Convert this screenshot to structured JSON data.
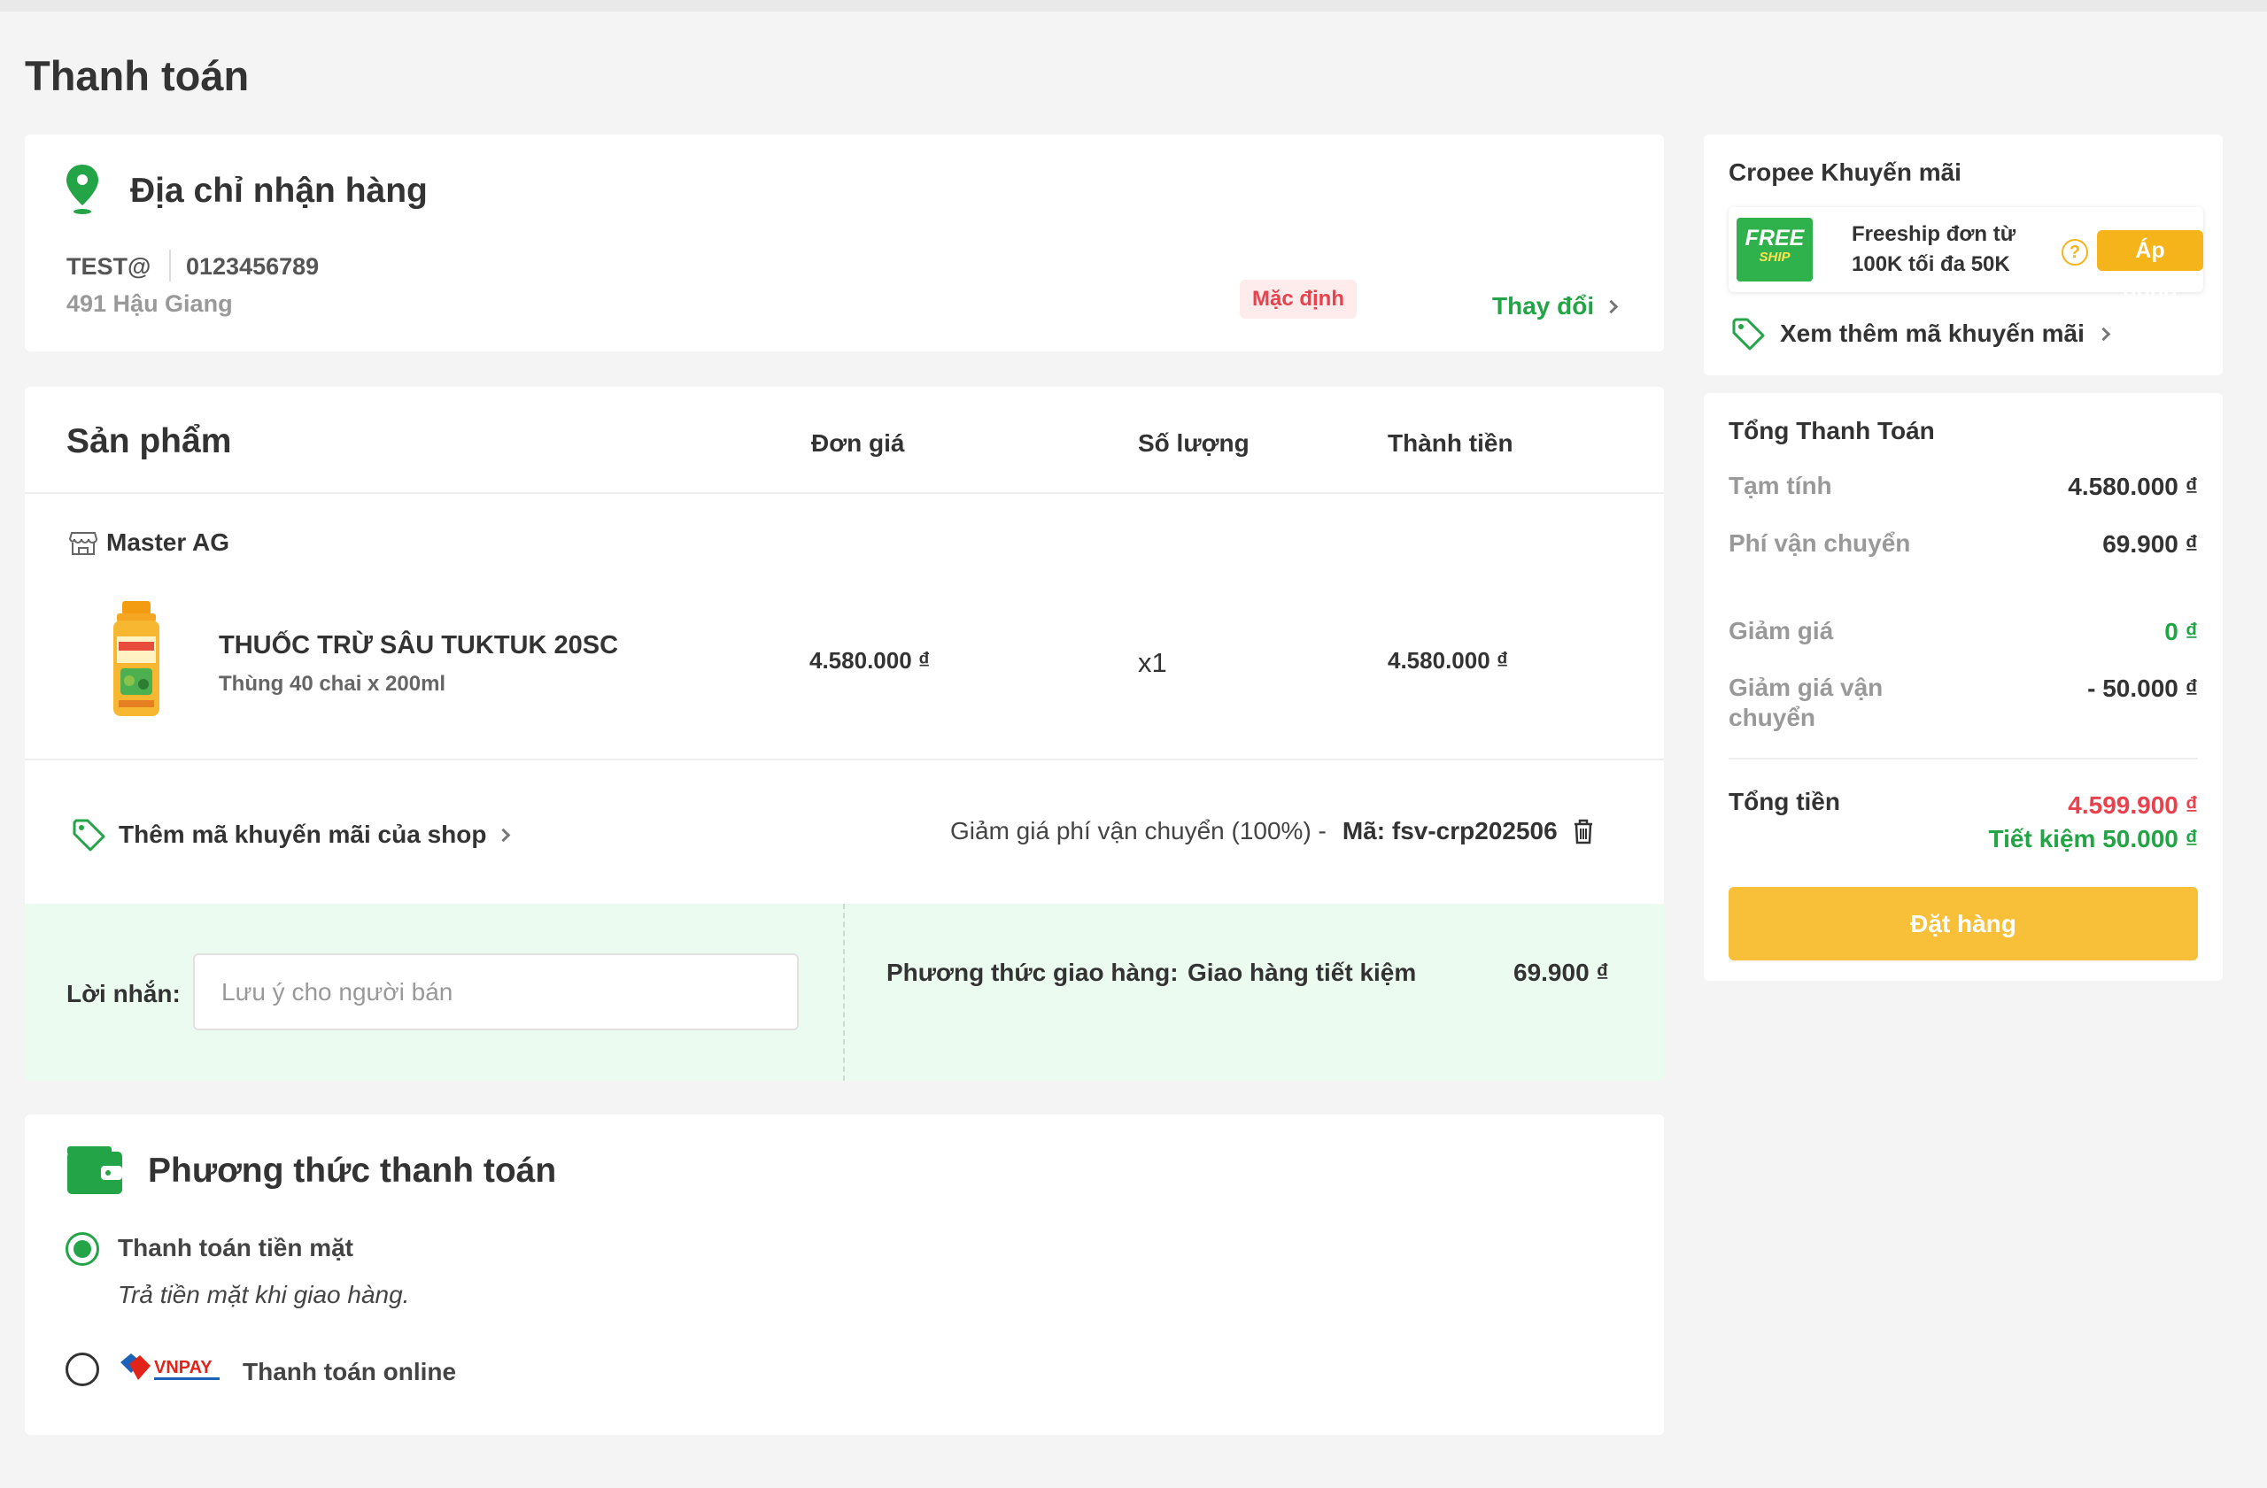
{
  "page": {
    "title": "Thanh toán"
  },
  "address": {
    "title": "Địa chỉ nhận hàng",
    "name": "TEST@",
    "phone": "0123456789",
    "street": "491 Hậu Giang",
    "default_badge": "Mặc định",
    "change_label": "Thay đổi"
  },
  "products": {
    "headers": {
      "product": "Sản phẩm",
      "unit_price": "Đơn giá",
      "quantity": "Số lượng",
      "total": "Thành tiền"
    },
    "shop_name": "Master AG",
    "items": [
      {
        "name": "THUỐC TRỪ SÂU TUKTUK 20SC",
        "variant": "Thùng 40 chai x 200ml",
        "unit_price": "4.580.000 ₫",
        "quantity": "x1",
        "total": "4.580.000 ₫"
      }
    ],
    "shop_voucher_label": "Thêm mã khuyến mãi của shop",
    "applied_voucher": {
      "description": "Giảm giá phí vận chuyển (100%) -",
      "code": "Mã: fsv-crp202506"
    },
    "note": {
      "label": "Lời nhắn:",
      "placeholder": "Lưu ý cho người bán",
      "value": ""
    },
    "shipping": {
      "label": "Phương thức giao hàng:",
      "method": "Giao hàng tiết kiệm",
      "fee": "69.900 ₫"
    }
  },
  "payment": {
    "title": "Phương thức thanh toán",
    "options": [
      {
        "label": "Thanh toán tiền mặt",
        "description": "Trả tiền mặt khi giao hàng.",
        "selected": true
      },
      {
        "label": "Thanh toán online",
        "provider": "VNPAY",
        "selected": false
      }
    ]
  },
  "promo": {
    "title": "Cropee Khuyến mãi",
    "voucher": {
      "badge_line1": "FREE",
      "badge_line2": "SHIP",
      "text_line1": "Freeship đơn từ",
      "text_line2": "100K tối đa 50K",
      "help": "?",
      "apply_label": "Áp dụng"
    },
    "more_label": "Xem thêm mã khuyến mãi"
  },
  "summary": {
    "title": "Tổng Thanh Toán",
    "rows": [
      {
        "label": "Tạm tính",
        "value": "4.580.000 ₫"
      },
      {
        "label": "Phí vận chuyển",
        "value": "69.900 ₫"
      },
      {
        "label": "Giảm giá",
        "value": "0 ₫"
      },
      {
        "label": "Giảm giá vận chuyển",
        "value": "- 50.000 ₫"
      }
    ],
    "total_label": "Tổng tiền",
    "total_value": "4.599.900 ₫",
    "saving": "Tiết kiệm 50.000 ₫",
    "order_button": "Đặt hàng"
  },
  "colors": {
    "brand_green": "#22a447",
    "accent_yellow": "#f5b41a",
    "order_button": "#f8c038",
    "total_red": "#e7424d"
  }
}
